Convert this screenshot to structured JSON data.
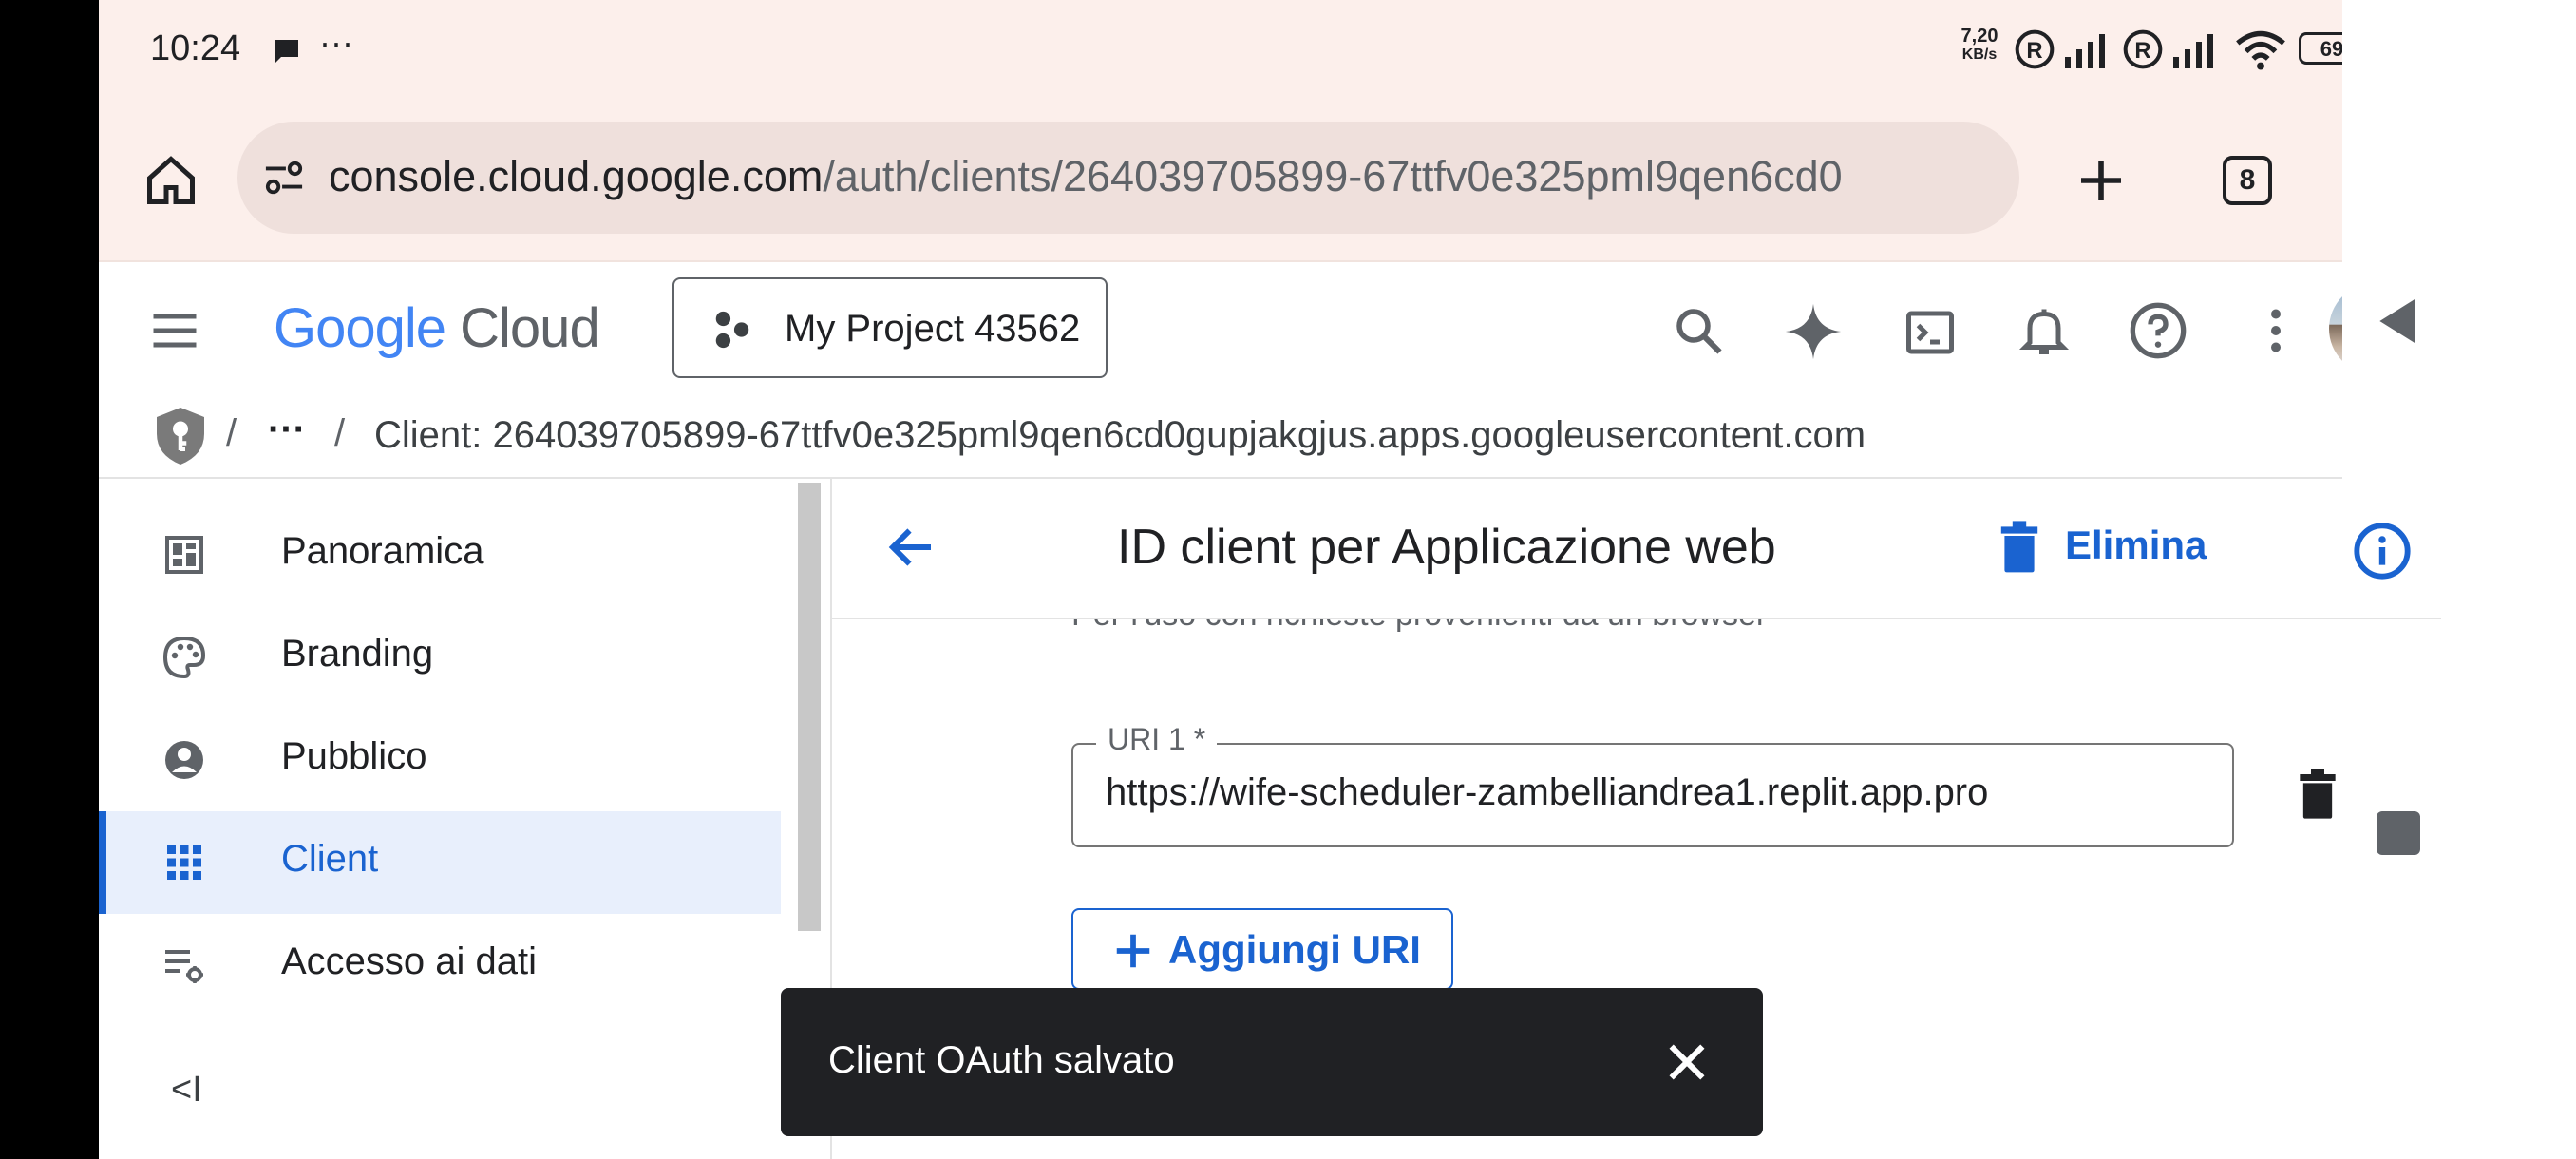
{
  "status_bar": {
    "time": "10:24",
    "more": "···",
    "net_speed_top": "7,20",
    "net_speed_bottom": "KB/s",
    "battery": "69"
  },
  "browser": {
    "url_domain": "console.cloud.google.com",
    "url_path": "/auth/clients/264039705899-67ttfv0e325pml9qen6cd0",
    "tab_count": "8"
  },
  "header": {
    "logo_google": "Google",
    "logo_cloud": "Cloud",
    "project_name": "My Project 43562"
  },
  "breadcrumb": {
    "sep": "/",
    "ellipsis": "···",
    "current": "Client: 264039705899-67ttfv0e325pml9qen6cd0gupjakgjus.apps.googleusercontent.com"
  },
  "sidebar": {
    "items": [
      {
        "label": "Panoramica",
        "icon": "dashboard-icon"
      },
      {
        "label": "Branding",
        "icon": "palette-icon"
      },
      {
        "label": "Pubblico",
        "icon": "account-circle-icon"
      },
      {
        "label": "Client",
        "icon": "apps-grid-icon",
        "active": true
      },
      {
        "label": "Accesso ai dati",
        "icon": "data-access-icon"
      }
    ],
    "collapse": "<I"
  },
  "main": {
    "title": "ID client per Applicazione web",
    "delete_label": "Elimina",
    "partial_text": "Per l'uso con richieste provenienti da un browser",
    "uri_label": "URI 1 *",
    "uri_value": "https://wife-scheduler-zambelliandrea1.replit.app.pro",
    "add_uri_label": "Aggiungi URI"
  },
  "snackbar": {
    "message": "Client OAuth salvato"
  },
  "colors": {
    "accent": "#1a63d0",
    "browser_bar": "#fcefeb",
    "snackbar": "#202124"
  }
}
